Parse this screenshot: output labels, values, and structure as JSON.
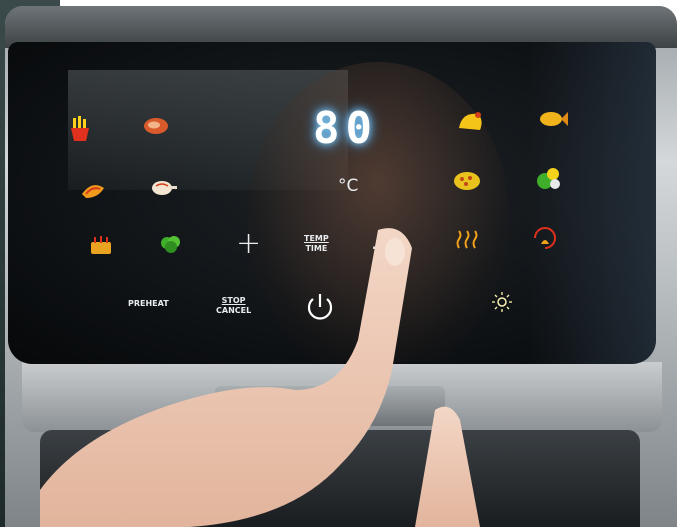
{
  "display": {
    "value": "80",
    "unit": "°C"
  },
  "buttons": {
    "plus": "+",
    "minus": "−",
    "temp_time_line1": "TEMP",
    "temp_time_line2": "TIME",
    "preheat": "PREHEAT",
    "stop_line1": "STOP",
    "stop_line2": "CANCEL"
  },
  "icons": [
    "fries-icon",
    "steak-icon",
    "shrimp-icon",
    "drumstick-icon",
    "cake-icon",
    "broccoli-icon",
    "chicken-icon",
    "fish-icon",
    "pizza-icon",
    "vegetables-icon",
    "dehydrate-icon",
    "reheat-icon",
    "light-icon",
    "power-icon"
  ],
  "colors": {
    "display_glow": "#3fa6ff",
    "icon_food": "#f2a21a",
    "panel": "#0d1013"
  }
}
